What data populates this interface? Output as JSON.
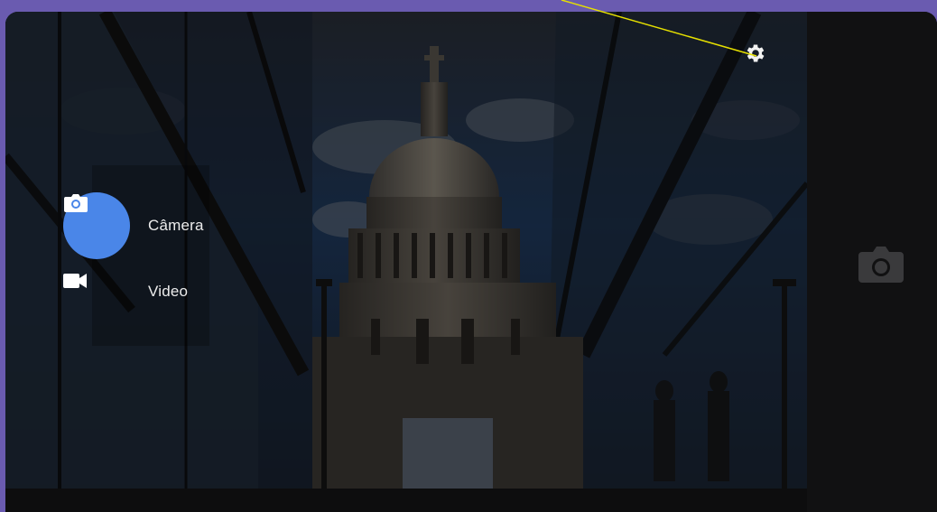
{
  "mode_menu": {
    "items": [
      {
        "label": "Câmera",
        "icon": "camera-icon",
        "selected": true
      },
      {
        "label": "Video",
        "icon": "videocam-icon",
        "selected": false
      }
    ]
  },
  "toolbar": {
    "settings_icon": "gear-icon",
    "shutter_icon": "camera-shutter-icon"
  },
  "colors": {
    "accent": "#4a86e8",
    "background": "#6a5bb0",
    "annotation": "#e6e000"
  }
}
